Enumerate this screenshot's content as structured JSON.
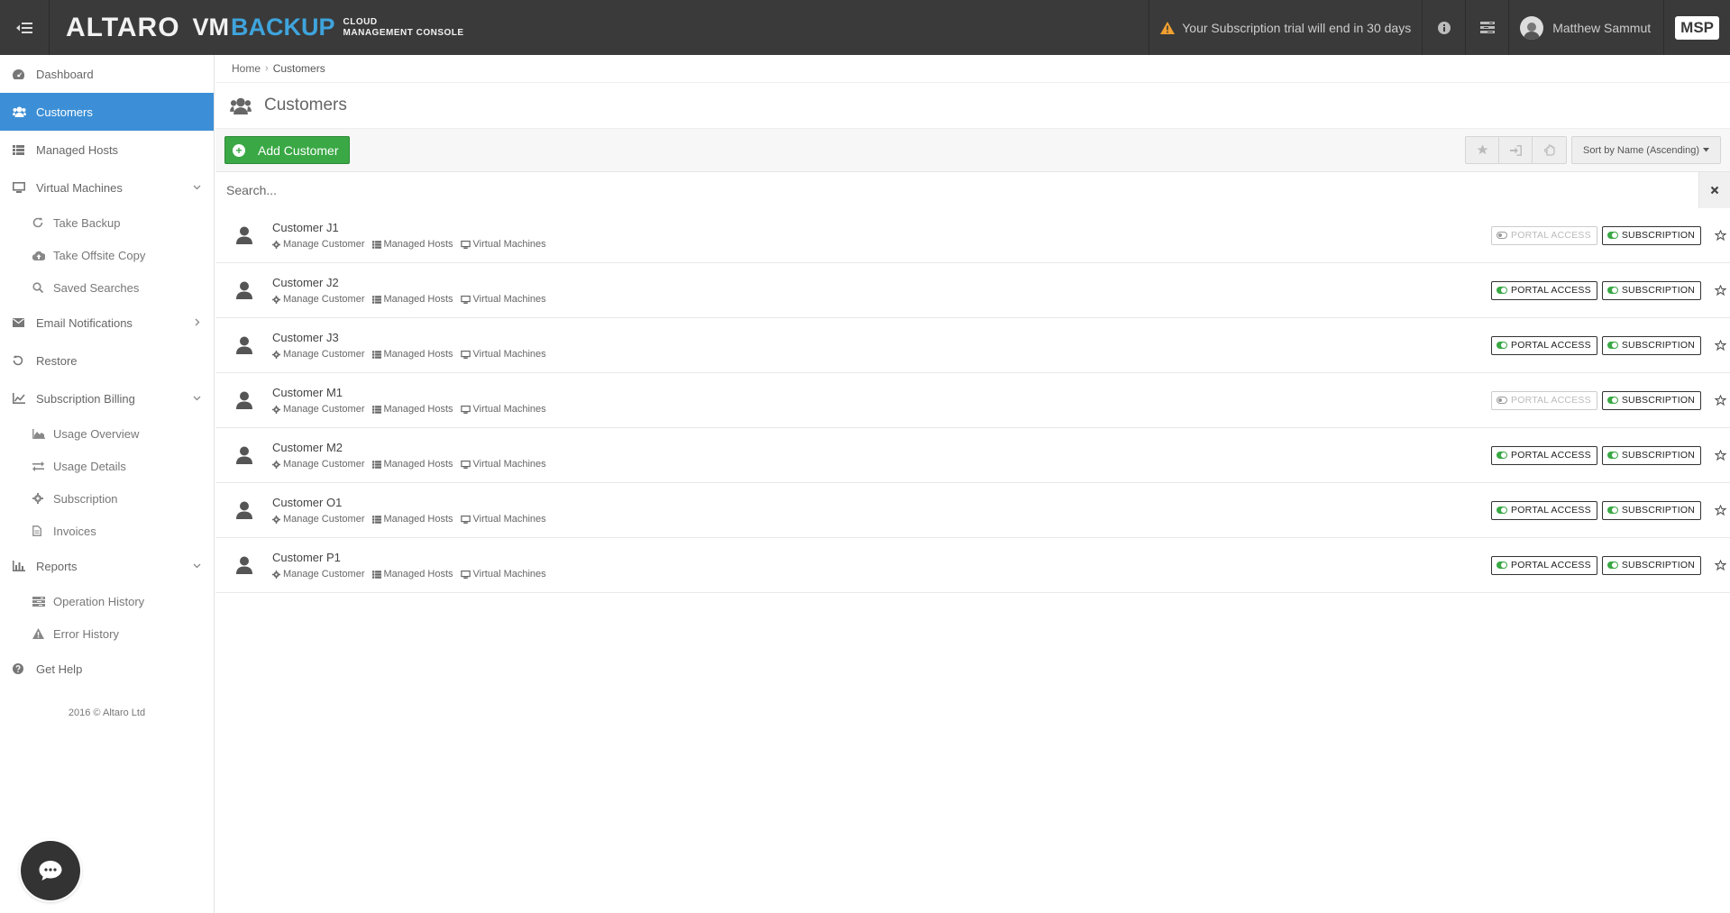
{
  "app": {
    "logo_main": "ALTARO",
    "logo_vm": "VM",
    "logo_backup": "BACKUP",
    "logo_sub1": "CLOUD",
    "logo_sub2": "MANAGEMENT CONSOLE"
  },
  "topbar": {
    "trial_text": "Your Subscription trial will end in 30 days",
    "user_name": "Matthew Sammut",
    "msp_label": "MSP"
  },
  "sidebar": {
    "items": [
      {
        "label": "Dashboard",
        "icon": "dashboard-icon"
      },
      {
        "label": "Customers",
        "icon": "users-icon",
        "active": true
      },
      {
        "label": "Managed Hosts",
        "icon": "list-icon"
      },
      {
        "label": "Virtual Machines",
        "icon": "monitor-icon",
        "expanded": true
      },
      {
        "label": "Take Backup",
        "icon": "refresh-icon",
        "sub": true
      },
      {
        "label": "Take Offsite Copy",
        "icon": "cloud-upload-icon",
        "sub": true
      },
      {
        "label": "Saved Searches",
        "icon": "search-icon",
        "sub": true
      },
      {
        "label": "Email Notifications",
        "icon": "envelope-icon"
      },
      {
        "label": "Restore",
        "icon": "undo-icon"
      },
      {
        "label": "Subscription Billing",
        "icon": "line-chart-icon",
        "expanded": true
      },
      {
        "label": "Usage Overview",
        "icon": "area-chart-icon",
        "sub": true
      },
      {
        "label": "Usage Details",
        "icon": "exchange-icon",
        "sub": true
      },
      {
        "label": "Subscription",
        "icon": "gear-icon",
        "sub": true
      },
      {
        "label": "Invoices",
        "icon": "file-icon",
        "sub": true
      },
      {
        "label": "Reports",
        "icon": "bar-chart-icon",
        "expanded": true
      },
      {
        "label": "Operation History",
        "icon": "history-list-icon",
        "sub": true
      },
      {
        "label": "Error History",
        "icon": "warning-icon",
        "sub": true
      },
      {
        "label": "Get Help",
        "icon": "question-icon"
      }
    ],
    "copyright": "2016 © Altaro Ltd"
  },
  "breadcrumb": {
    "home": "Home",
    "current": "Customers"
  },
  "page": {
    "title": "Customers"
  },
  "toolbar": {
    "add_label": "Add Customer",
    "sort_label": "Sort by Name (Ascending)"
  },
  "search": {
    "placeholder": "Search...",
    "value": ""
  },
  "customers": {
    "link_manage": "Manage Customer",
    "link_hosts": "Managed Hosts",
    "link_vms": "Virtual Machines",
    "badge_portal": "PORTAL ACCESS",
    "badge_subscription": "SUBSCRIPTION",
    "rows": [
      {
        "name": "Customer J1",
        "portal": false,
        "subscription": true
      },
      {
        "name": "Customer J2",
        "portal": true,
        "subscription": true
      },
      {
        "name": "Customer J3",
        "portal": true,
        "subscription": true
      },
      {
        "name": "Customer M1",
        "portal": false,
        "subscription": true
      },
      {
        "name": "Customer M2",
        "portal": true,
        "subscription": true
      },
      {
        "name": "Customer O1",
        "portal": true,
        "subscription": true
      },
      {
        "name": "Customer P1",
        "portal": true,
        "subscription": true
      }
    ]
  },
  "colors": {
    "topbar": "#3a3a3a",
    "active_nav": "#3c8fd6",
    "add_button": "#3aa845",
    "logo_backup": "#3fa4dc",
    "warning": "#f0a030"
  }
}
